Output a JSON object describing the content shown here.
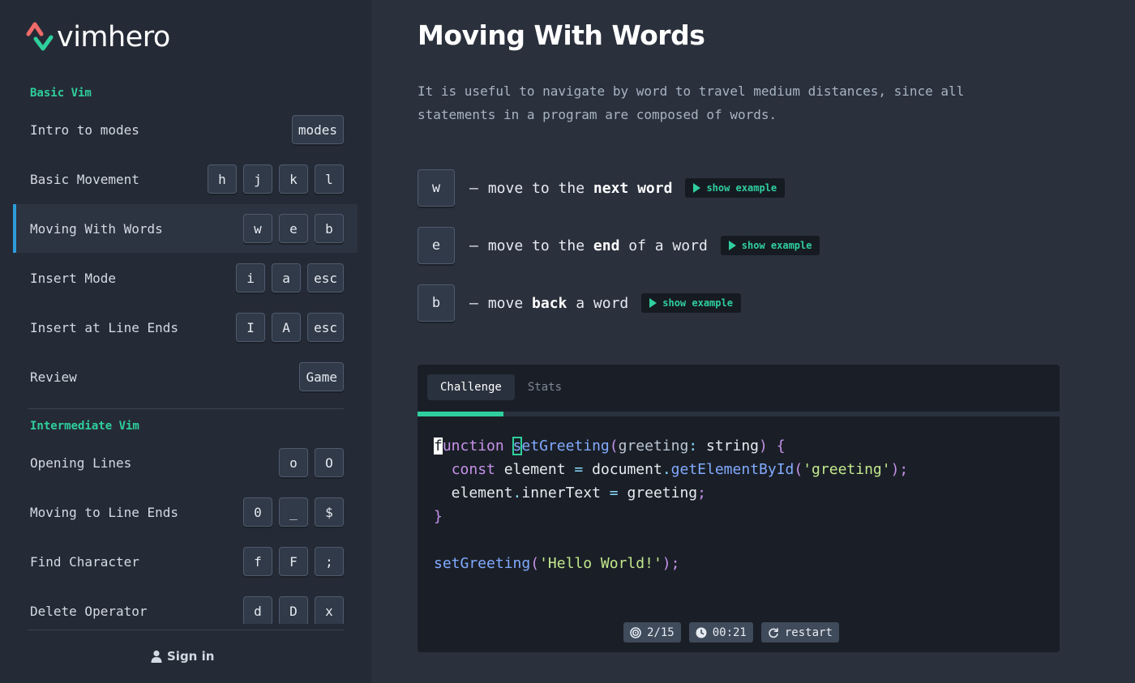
{
  "app": {
    "name": "vimhero"
  },
  "sidebar": {
    "sections": [
      {
        "title": "Basic Vim"
      },
      {
        "title": "Intermediate Vim"
      }
    ],
    "items": [
      {
        "label": "Intro to modes",
        "keys": [
          "modes"
        ],
        "active": false
      },
      {
        "label": "Basic Movement",
        "keys": [
          "h",
          "j",
          "k",
          "l"
        ],
        "active": false
      },
      {
        "label": "Moving With Words",
        "keys": [
          "w",
          "e",
          "b"
        ],
        "active": true
      },
      {
        "label": "Insert Mode",
        "keys": [
          "i",
          "a",
          "esc"
        ],
        "active": false
      },
      {
        "label": "Insert at Line Ends",
        "keys": [
          "I",
          "A",
          "esc"
        ],
        "active": false
      },
      {
        "label": "Review",
        "keys": [
          "Game"
        ],
        "active": false
      },
      {
        "label": "Opening Lines",
        "keys": [
          "o",
          "O"
        ],
        "active": false
      },
      {
        "label": "Moving to Line Ends",
        "keys": [
          "0",
          "_",
          "$"
        ],
        "active": false
      },
      {
        "label": "Find Character",
        "keys": [
          "f",
          "F",
          ";"
        ],
        "active": false
      },
      {
        "label": "Delete Operator",
        "keys": [
          "d",
          "D",
          "x"
        ],
        "active": false
      }
    ],
    "signin_label": "Sign in"
  },
  "main": {
    "title": "Moving With Words",
    "intro": "It is useful to navigate by word to travel medium distances, since all statements in a program are composed of words.",
    "dash": "–",
    "show_example_label": "show example",
    "commands": [
      {
        "key": "w",
        "pre": "move to the ",
        "bold": "next word",
        "post": ""
      },
      {
        "key": "e",
        "pre": "move to the ",
        "bold": "end",
        "post": " of a word"
      },
      {
        "key": "b",
        "pre": "move ",
        "bold": "back",
        "post": " a word"
      }
    ]
  },
  "challenge": {
    "tabs": [
      "Challenge",
      "Stats"
    ],
    "active_tab": "Challenge",
    "progress_fraction": 0.1333,
    "code_lines": [
      "function setGreeting(greeting: string) {",
      "  const element = document.getElementById('greeting');",
      "  element.innerText = greeting;",
      "}",
      "",
      "setGreeting('Hello World!');"
    ],
    "stats": {
      "targets": "2/15",
      "timer": "00:21",
      "restart_label": "restart"
    }
  },
  "colors": {
    "accent": "#2fcf9d",
    "active_bar": "#2d9cdb",
    "logo_red": "#f06a6a",
    "logo_green": "#2fcf9d"
  },
  "icons": [
    "vimhero-logo",
    "user-icon",
    "play-icon",
    "target-icon",
    "clock-icon",
    "refresh-icon"
  ]
}
